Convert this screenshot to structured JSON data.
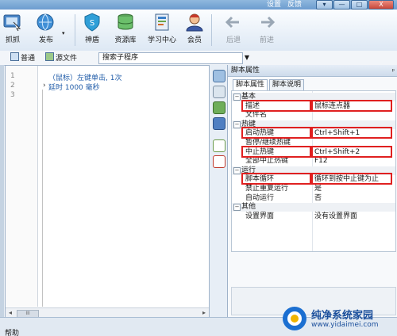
{
  "titlebar": {
    "settings": "设置",
    "feedback": "反馈",
    "min": "—",
    "max": "□",
    "close": "X"
  },
  "toolbar": {
    "items": [
      {
        "label": "抓抓",
        "icon": "capture-icon"
      },
      {
        "label": "发布",
        "icon": "publish-icon"
      },
      {
        "label": "神盾",
        "icon": "shield-icon"
      },
      {
        "label": "资源库",
        "icon": "library-icon"
      },
      {
        "label": "学习中心",
        "icon": "learning-icon"
      },
      {
        "label": "会员",
        "icon": "member-icon"
      },
      {
        "label": "后退",
        "icon": "back-arrow-icon"
      },
      {
        "label": "前进",
        "icon": "forward-arrow-icon"
      }
    ]
  },
  "docbar": {
    "normal_tab": "普通",
    "source_tab": "源文件",
    "search_placeholder": "搜索子程序"
  },
  "editor": {
    "lines": [
      {
        "num": "1",
        "text": "（鼠标）左键单击, 1次"
      },
      {
        "num": "2",
        "text": "延时 1000 毫秒"
      },
      {
        "num": "3",
        "text": ""
      }
    ],
    "scroll_thumb": "III"
  },
  "panel": {
    "title": "脚本属性",
    "pin": "ᵖ",
    "tabs": [
      "脚本属性",
      "脚本说明"
    ],
    "rows": [
      {
        "type": "cat",
        "key": "基本"
      },
      {
        "type": "prop",
        "key": "描述",
        "value": "鼠标连点器"
      },
      {
        "type": "prop",
        "key": "文件名",
        "value": ""
      },
      {
        "type": "cat",
        "key": "热键"
      },
      {
        "type": "prop",
        "key": "启动热键",
        "value": "Ctrl+Shift+1"
      },
      {
        "type": "prop",
        "key": "暂停/继续热键",
        "value": ""
      },
      {
        "type": "prop",
        "key": "中止热键",
        "value": "Ctrl+Shift+2"
      },
      {
        "type": "prop",
        "key": "全部中止热键",
        "value": "F12"
      },
      {
        "type": "cat",
        "key": "运行"
      },
      {
        "type": "prop",
        "key": "脚本循环",
        "value": "循环到按中止键为止"
      },
      {
        "type": "prop",
        "key": "禁止重复运行",
        "value": "是"
      },
      {
        "type": "prop",
        "key": "自动运行",
        "value": "否"
      },
      {
        "type": "cat",
        "key": "其他"
      },
      {
        "type": "prop",
        "key": "设置界面",
        "value": "没有设置界面"
      }
    ]
  },
  "status": {
    "text": "帮助"
  },
  "watermark": {
    "name": "纯净系统家园",
    "url": "www.yidaimei.com"
  },
  "colors": {
    "highlight": "#e02020",
    "code": "#1f5ba8",
    "brand": "#1b4f9c"
  }
}
